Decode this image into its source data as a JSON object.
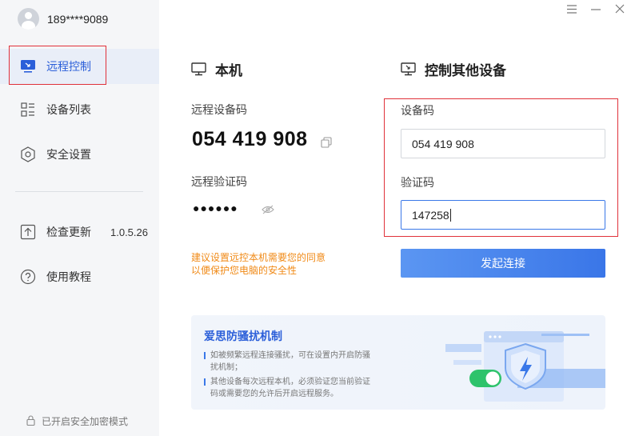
{
  "sidebar": {
    "user_name": "189****9089",
    "items": [
      {
        "label": "远程控制",
        "icon": "monitor-icon"
      },
      {
        "label": "设备列表",
        "icon": "list-icon"
      },
      {
        "label": "安全设置",
        "icon": "shield-hex-icon"
      },
      {
        "label": "检查更新",
        "icon": "upload-icon",
        "version": "1.0.5.26"
      },
      {
        "label": "使用教程",
        "icon": "help-icon"
      }
    ],
    "footer": "已开启安全加密模式"
  },
  "window": {
    "controls": [
      "menu-icon",
      "minimize-icon",
      "close-icon"
    ]
  },
  "local": {
    "title": "本机",
    "device_code_label": "远程设备码",
    "device_code": "054 419 908",
    "verify_label": "远程验证码",
    "verify_masked": "●●●●●●",
    "warning_line1": "建议设置远控本机需要您的同意",
    "warning_line2": "以便保护您电脑的安全性"
  },
  "remote": {
    "title": "控制其他设备",
    "device_code_label": "设备码",
    "device_code_value": "054 419 908",
    "verify_label": "验证码",
    "verify_value": "147258",
    "connect_label": "发起连接"
  },
  "banner": {
    "title": "爱思防骚扰机制",
    "item1": "如被频繁远程连接骚扰，可在设置内开启防骚扰机制；",
    "item2": "其他设备每次远程本机，必须验证您当前验证码或需要您的允许后开启远程服务。"
  },
  "colors": {
    "accent": "#3a78e8",
    "highlight_border": "#e0313a",
    "warning": "#f08a17",
    "toggle_on": "#2ec36b"
  }
}
